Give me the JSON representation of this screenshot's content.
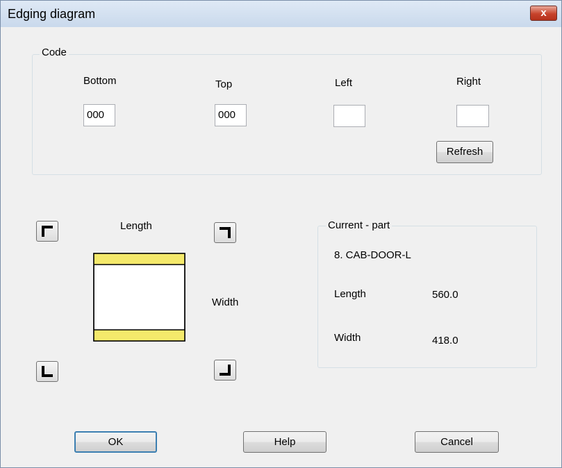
{
  "window": {
    "title": "Edging diagram",
    "close_glyph": "x"
  },
  "code_group": {
    "label": "Code",
    "columns": [
      {
        "label": "Bottom",
        "value": "000"
      },
      {
        "label": "Top",
        "value": "000"
      },
      {
        "label": "Left",
        "value": ""
      },
      {
        "label": "Right",
        "value": ""
      }
    ],
    "refresh_label": "Refresh"
  },
  "diagram": {
    "length_label": "Length",
    "width_label": "Width",
    "edge_color": "#f4e96b",
    "corner_icons": [
      "corner-top-left-icon",
      "corner-top-right-icon",
      "corner-bottom-left-icon",
      "corner-bottom-right-icon"
    ]
  },
  "current_part": {
    "label": "Current - part",
    "name": "8. CAB-DOOR-L",
    "length_label": "Length",
    "length_value": "560.0",
    "width_label": "Width",
    "width_value": "418.0"
  },
  "buttons": {
    "ok": "OK",
    "help": "Help",
    "cancel": "Cancel"
  }
}
